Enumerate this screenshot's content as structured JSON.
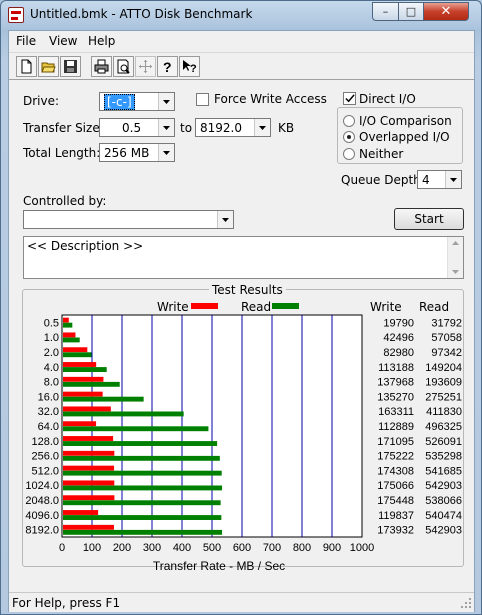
{
  "window": {
    "title": "Untitled.bmk - ATTO Disk Benchmark",
    "min": "–",
    "max": "□",
    "close": "✕"
  },
  "menu": {
    "file": "File",
    "view": "View",
    "help": "Help"
  },
  "toolbar": [
    "new-icon",
    "open-icon",
    "save-icon",
    "print-icon",
    "print-preview-icon",
    "move-icon",
    "help-icon",
    "context-help-icon"
  ],
  "settings": {
    "drive_label": "Drive:",
    "drive_value": "[-c-]",
    "force_write_label": "Force Write Access",
    "force_write_checked": false,
    "direct_io_label": "Direct I/O",
    "direct_io_checked": true,
    "transfer_size_label": "Transfer Size:",
    "transfer_from": "0.5",
    "to_label": "to",
    "transfer_to": "8192.0",
    "kb_label": "KB",
    "total_length_label": "Total Length:",
    "total_length": "256 MB",
    "io_comparison": "I/O Comparison",
    "overlapped_io": "Overlapped I/O",
    "neither": "Neither",
    "selected_mode": "overlapped",
    "queue_depth_label": "Queue Depth:",
    "queue_depth": "4",
    "controlled_by_label": "Controlled by:",
    "controlled_by": "",
    "start_button": "Start",
    "description": "<< Description >>"
  },
  "results": {
    "group_title": "Test Results",
    "write_legend": "Write",
    "read_legend": "Read",
    "write_header": "Write",
    "read_header": "Read",
    "write_color": "#ff0000",
    "read_color": "#008000"
  },
  "chart_data": {
    "type": "bar",
    "orientation": "horizontal",
    "categories": [
      "0.5",
      "1.0",
      "2.0",
      "4.0",
      "8.0",
      "16.0",
      "32.0",
      "64.0",
      "128.0",
      "256.0",
      "512.0",
      "1024.0",
      "2048.0",
      "4096.0",
      "8192.0"
    ],
    "series": [
      {
        "name": "Write",
        "values": [
          19790,
          42496,
          82980,
          113188,
          137968,
          135270,
          163311,
          112889,
          171095,
          175222,
          174308,
          175066,
          175448,
          119837,
          173932
        ]
      },
      {
        "name": "Read",
        "values": [
          31792,
          57058,
          97342,
          149204,
          193609,
          275251,
          411830,
          496325,
          526091,
          535298,
          541685,
          542903,
          538066,
          540474,
          542903
        ]
      }
    ],
    "xlabel": "Transfer Rate - MB / Sec",
    "xticks": [
      "0",
      "100",
      "200",
      "300",
      "400",
      "500",
      "600",
      "700",
      "800",
      "900",
      "1000"
    ],
    "xlim": [
      0,
      1000
    ],
    "value_unit_divisor": 1024,
    "grid": true,
    "legend": "top"
  },
  "status": "For Help, press F1"
}
